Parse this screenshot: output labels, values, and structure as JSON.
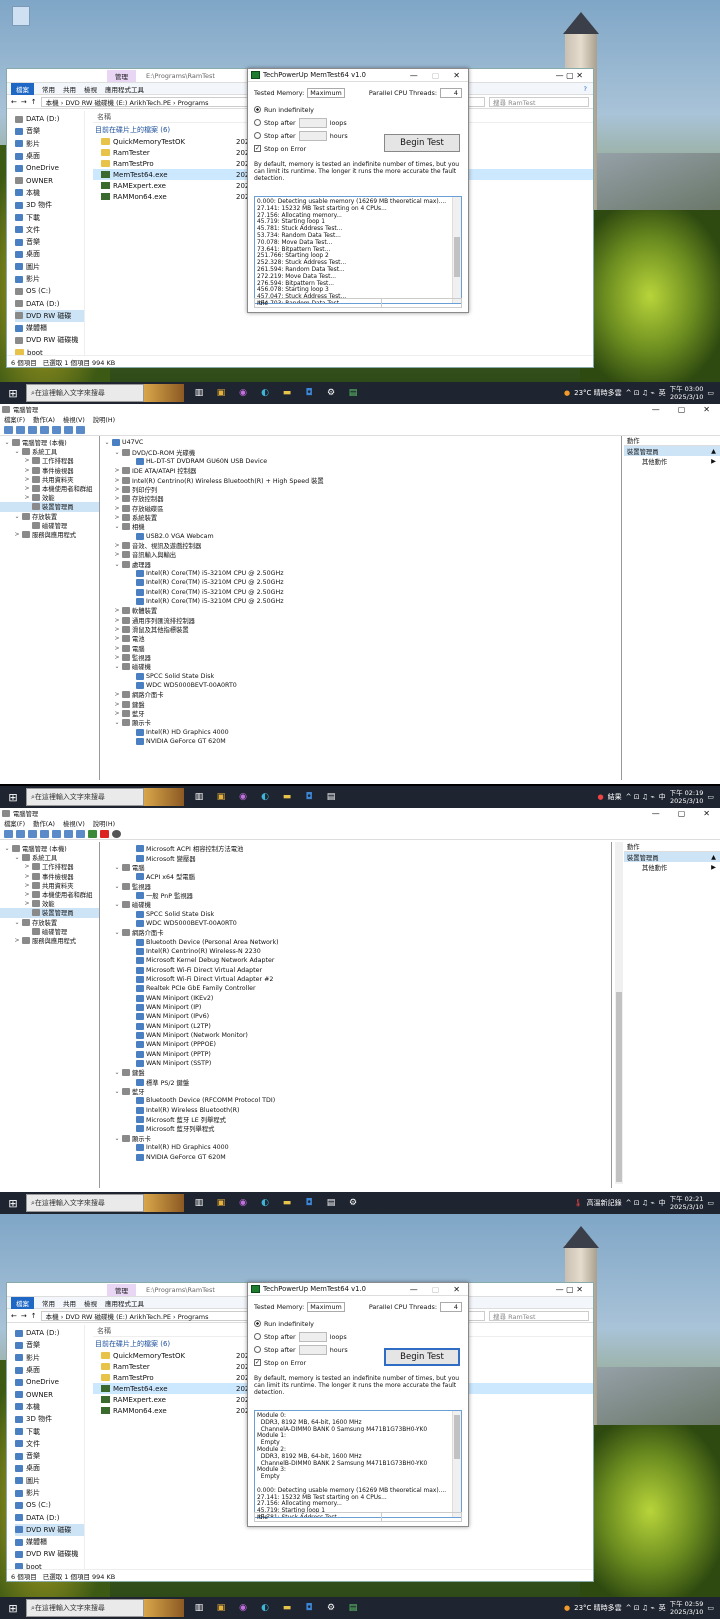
{
  "explorer": {
    "tab_manage": "管理",
    "path_label": "E:\\Programs\\RamTest",
    "ribbon": [
      "檔案",
      "常用",
      "共用",
      "檢視",
      "應用程式工具"
    ],
    "address": "本機 › DVD RW 磁碟機 (E:) ArikhTech.PE › Programs",
    "search_placeholder": "搜尋 RamTest",
    "nav": [
      "DATA (D:)",
      "音樂",
      "影片",
      "桌面",
      "OneDrive",
      "OWNER",
      "本機",
      "3D 物件",
      "下載",
      "文件",
      "音樂",
      "桌面",
      "圖片",
      "影片",
      "OS (C:)",
      "DATA (D:)",
      "DVD RW 磁碟",
      "媒體櫃",
      "DVD RW 磁碟機",
      "boot"
    ],
    "col_name": "名稱",
    "group": "目前在碟片上的檔案 (6)",
    "files": [
      "QuickMemoryTestOK",
      "RamTester",
      "RamTestPro",
      "MemTest64.exe",
      "RAMExpert.exe",
      "RAMMon64.exe"
    ],
    "file_dates": [
      "202",
      "202",
      "202",
      "202",
      "202",
      "202"
    ],
    "status": [
      "6 個項目",
      "已選取 1 個項目 994 KB"
    ]
  },
  "memtest": {
    "title": "TechPowerUp MemTest64 v1.0",
    "tested_memory_label": "Tested Memory:",
    "tested_memory_value": "Maximum",
    "threads_label": "Parallel CPU Threads:",
    "threads_value": "4",
    "run_indef": "Run indefinitely",
    "stop_after": "Stop after",
    "loops": "loops",
    "hours": "hours",
    "stop_on_error": "Stop on Error",
    "begin": "Begin Test",
    "desc": "By default, memory is tested an indefinite number of times, but you can limit its runtime. The longer it runs the more accurate the fault detection.",
    "status": "Idle",
    "log1": "0.000: Detecting usable memory (16269 MB theoretical max)....\n27.141: 15232 MB Test starting on 4 CPUs...\n27.156: Allocating memory...\n45.719: Starting loop 1\n45.781: Stuck Address Test...\n53.734: Random Data Test...\n70.078: Move Data Test...\n73.641: Bitpattern Test...\n251.766: Starting loop 2\n252.328: Stuck Address Test...\n261.594: Random Data Test...\n272.219: Move Data Test...\n276.594: Bitpattern Test...\n456.078: Starting loop 3\n457.047: Stuck Address Test...\n464.703: Random Data Test...",
    "log2": "Module 0:\n  DDR3, 8192 MB, 64-bit, 1600 MHz\n  ChannelA-DIMM0 BANK 0 Samsung M471B1G73BH0-YK0\nModule 1:\n  Empty\nModule 2:\n  DDR3, 8192 MB, 64-bit, 1600 MHz\n  ChannelB-DIMM0 BANK 2 Samsung M471B1G73BH0-YK0\nModule 3:\n  Empty\n\n0.000: Detecting usable memory (16269 MB theoretical max)....\n27.141: 15232 MB Test starting on 4 CPUs...\n27.156: Allocating memory...\n45.719: Starting loop 1\n45.781: Stuck Address Test..."
  },
  "taskbar": {
    "search": "在這裡輸入文字來搜尋",
    "weather1": "23°C 晴時多雲",
    "time1": "下午 03:00",
    "date1": "2025/3/10",
    "weather2": "結果",
    "time2": "下午 02:19",
    "date2": "2025/3/10",
    "weather3": "高溫新記錄",
    "time3": "下午 02:21",
    "date3": "2025/3/10",
    "weather4": "23°C 晴時多雲",
    "time4": "下午 02:59",
    "date4": "2025/3/10",
    "ime": "英",
    "ime2": "中"
  },
  "devmgr": {
    "title": "電腦管理",
    "menu": [
      "檔案(F)",
      "動作(A)",
      "檢視(V)",
      "說明(H)"
    ],
    "left": [
      "電腦管理 (本機)",
      "系統工具",
      "工作排程器",
      "事件檢視器",
      "共用資料夾",
      "本機使用者和群組",
      "效能",
      "裝置管理員",
      "存放裝置",
      "磁碟管理",
      "服務與應用程式"
    ],
    "actions_header": "動作",
    "actions_sel": "裝置管理員",
    "actions_more": "其他動作",
    "tree1": [
      "U47VC",
      "DVD/CD-ROM 光碟機",
      "HL-DT-ST DVDRAM GU60N USB Device",
      "IDE ATA/ATAPI 控制器",
      "Intel(R) Centrino(R) Wireless Bluetooth(R) + High Speed 裝置",
      "列印佇列",
      "存放控制器",
      "存放磁碟區",
      "系統裝置",
      "相機",
      "USB2.0 VGA Webcam",
      "音效、視訊及遊戲控制器",
      "音訊輸入與輸出",
      "處理器",
      "Intel(R) Core(TM) i5-3210M CPU @ 2.50GHz",
      "Intel(R) Core(TM) i5-3210M CPU @ 2.50GHz",
      "Intel(R) Core(TM) i5-3210M CPU @ 2.50GHz",
      "Intel(R) Core(TM) i5-3210M CPU @ 2.50GHz",
      "軟體裝置",
      "通用序列匯流排控制器",
      "滑鼠及其他指標裝置",
      "電池",
      "電腦",
      "監視器",
      "磁碟機",
      "SPCC Solid State Disk",
      "WDC WD5000BEVT-00A0RT0",
      "網路介面卡",
      "鍵盤",
      "藍牙",
      "顯示卡",
      "Intel(R) HD Graphics 4000",
      "NVIDIA GeForce GT 620M"
    ],
    "tree2": [
      "Microsoft ACPI 相容控制方法電池",
      "Microsoft 變壓器",
      "電腦",
      "ACPI x64 型電腦",
      "監視器",
      "一般 PnP 監視器",
      "磁碟機",
      "SPCC Solid State Disk",
      "WDC WD5000BEVT-00A0RT0",
      "網路介面卡",
      "Bluetooth Device (Personal Area Network)",
      "Intel(R) Centrino(R) Wireless-N 2230",
      "Microsoft Kernel Debug Network Adapter",
      "Microsoft Wi-Fi Direct Virtual Adapter",
      "Microsoft Wi-Fi Direct Virtual Adapter #2",
      "Realtek PCIe GbE Family Controller",
      "WAN Miniport (IKEv2)",
      "WAN Miniport (IP)",
      "WAN Miniport (IPv6)",
      "WAN Miniport (L2TP)",
      "WAN Miniport (Network Monitor)",
      "WAN Miniport (PPPOE)",
      "WAN Miniport (PPTP)",
      "WAN Miniport (SSTP)",
      "鍵盤",
      "標準 PS/2 鍵盤",
      "藍牙",
      "Bluetooth Device (RFCOMM Protocol TDI)",
      "Intel(R) Wireless Bluetooth(R)",
      "Microsoft 藍牙 LE 列舉程式",
      "Microsoft 藍牙列舉程式",
      "顯示卡",
      "Intel(R) HD Graphics 4000",
      "NVIDIA GeForce GT 620M"
    ]
  }
}
